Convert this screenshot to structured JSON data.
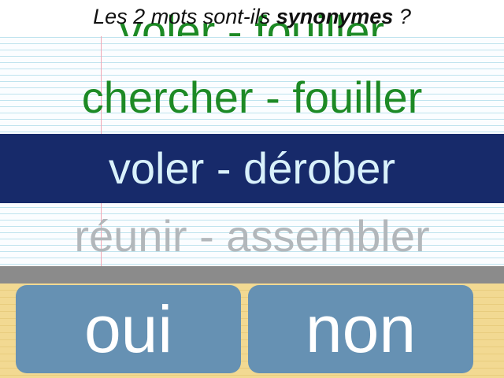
{
  "question": {
    "prefix": "Les 2 mots sont-ils ",
    "emphasis": "synonymes",
    "suffix": " ?"
  },
  "pairs": {
    "previous": "voler - fouiller",
    "above": "chercher - fouiller",
    "current": "voler - dérober",
    "next": "réunir - assembler"
  },
  "buttons": {
    "yes": "oui",
    "no": "non"
  },
  "colors": {
    "correct_green": "#1d8a25",
    "highlight_navy": "#172a6a",
    "current_text": "#d9f1fb",
    "upcoming_gray": "#b2b7bb",
    "button_blue": "#6691b3",
    "pad_yellow": "#f2d992"
  }
}
